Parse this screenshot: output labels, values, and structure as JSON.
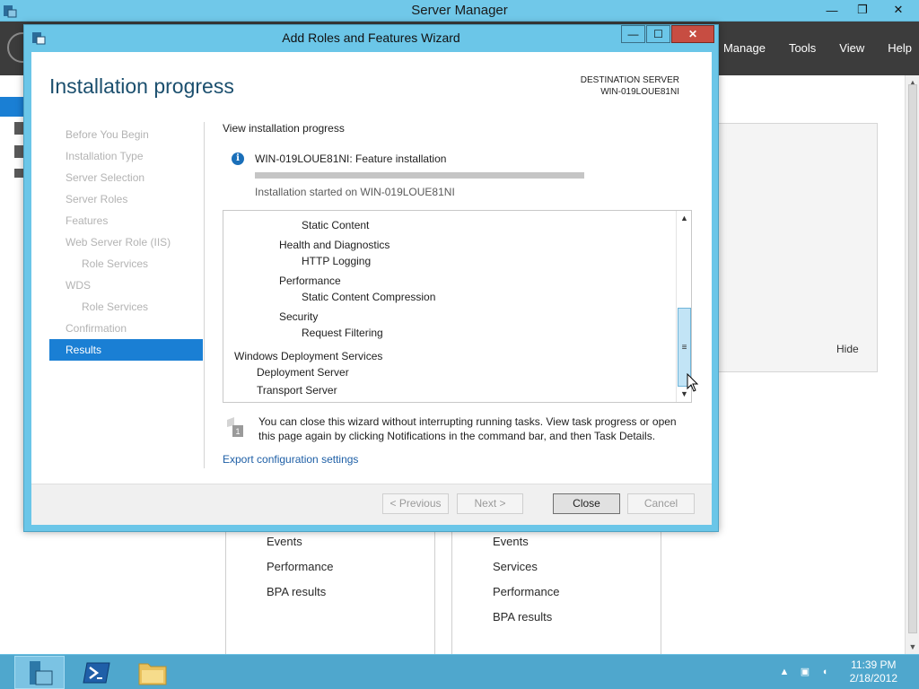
{
  "server_manager": {
    "title": "Server Manager",
    "menu": [
      "Manage",
      "Tools",
      "View",
      "Help"
    ],
    "window_buttons": {
      "minimize": "—",
      "restore": "❐",
      "close": "✕"
    },
    "welcome_hide": "Hide",
    "panel_left_items": [
      "Events",
      "Performance",
      "BPA results"
    ],
    "panel_right_items": [
      "Events",
      "Services",
      "Performance",
      "BPA results"
    ]
  },
  "wizard": {
    "title": "Add Roles and Features Wizard",
    "window_buttons": {
      "minimize": "—",
      "maximize": "☐",
      "close": "✕"
    },
    "heading": "Installation progress",
    "destination_label": "DESTINATION SERVER",
    "destination_server": "WIN-019LOUE81NI",
    "steps": [
      {
        "label": "Before You Begin",
        "sub": false,
        "active": false
      },
      {
        "label": "Installation Type",
        "sub": false,
        "active": false
      },
      {
        "label": "Server Selection",
        "sub": false,
        "active": false
      },
      {
        "label": "Server Roles",
        "sub": false,
        "active": false
      },
      {
        "label": "Features",
        "sub": false,
        "active": false
      },
      {
        "label": "Web Server Role (IIS)",
        "sub": false,
        "active": false
      },
      {
        "label": "Role Services",
        "sub": true,
        "active": false
      },
      {
        "label": "WDS",
        "sub": false,
        "active": false
      },
      {
        "label": "Role Services",
        "sub": true,
        "active": false
      },
      {
        "label": "Confirmation",
        "sub": false,
        "active": false
      },
      {
        "label": "Results",
        "sub": false,
        "active": true
      }
    ],
    "view_progress_label": "View installation progress",
    "feature_install_title": "WIN-019LOUE81NI: Feature installation",
    "progress_fraction": 1.0,
    "install_started": "Installation started on WIN-019LOUE81NI",
    "result_items": [
      {
        "text": "Static Content",
        "level": 3,
        "bold": false
      },
      {
        "text": "Health and Diagnostics",
        "level": 2,
        "bold": false
      },
      {
        "text": "HTTP Logging",
        "level": 3,
        "bold": false
      },
      {
        "text": "Performance",
        "level": 2,
        "bold": false
      },
      {
        "text": "Static Content Compression",
        "level": 3,
        "bold": false
      },
      {
        "text": "Security",
        "level": 2,
        "bold": false
      },
      {
        "text": "Request Filtering",
        "level": 3,
        "bold": false
      },
      {
        "text": "Windows Deployment Services",
        "level": 1,
        "bold": false
      },
      {
        "text": "Deployment Server",
        "level": 2,
        "bold": false
      },
      {
        "text": "Transport Server",
        "level": 2,
        "bold": false
      }
    ],
    "note": "You can close this wizard without interrupting running tasks. View task progress or open this page again by clicking Notifications in the command bar, and then Task Details.",
    "export_link": "Export configuration settings",
    "buttons": {
      "previous": "< Previous",
      "next": "Next >",
      "close": "Close",
      "cancel": "Cancel"
    }
  },
  "taskbar": {
    "time": "11:39 PM",
    "date": "2/18/2012"
  },
  "colors": {
    "titlebar": "#70c8e9",
    "header": "#3c3c3c",
    "selected": "#1a7fd4",
    "taskbar": "#4fa7cd",
    "heading": "#1b4f6e",
    "link": "#1e5fa6"
  }
}
